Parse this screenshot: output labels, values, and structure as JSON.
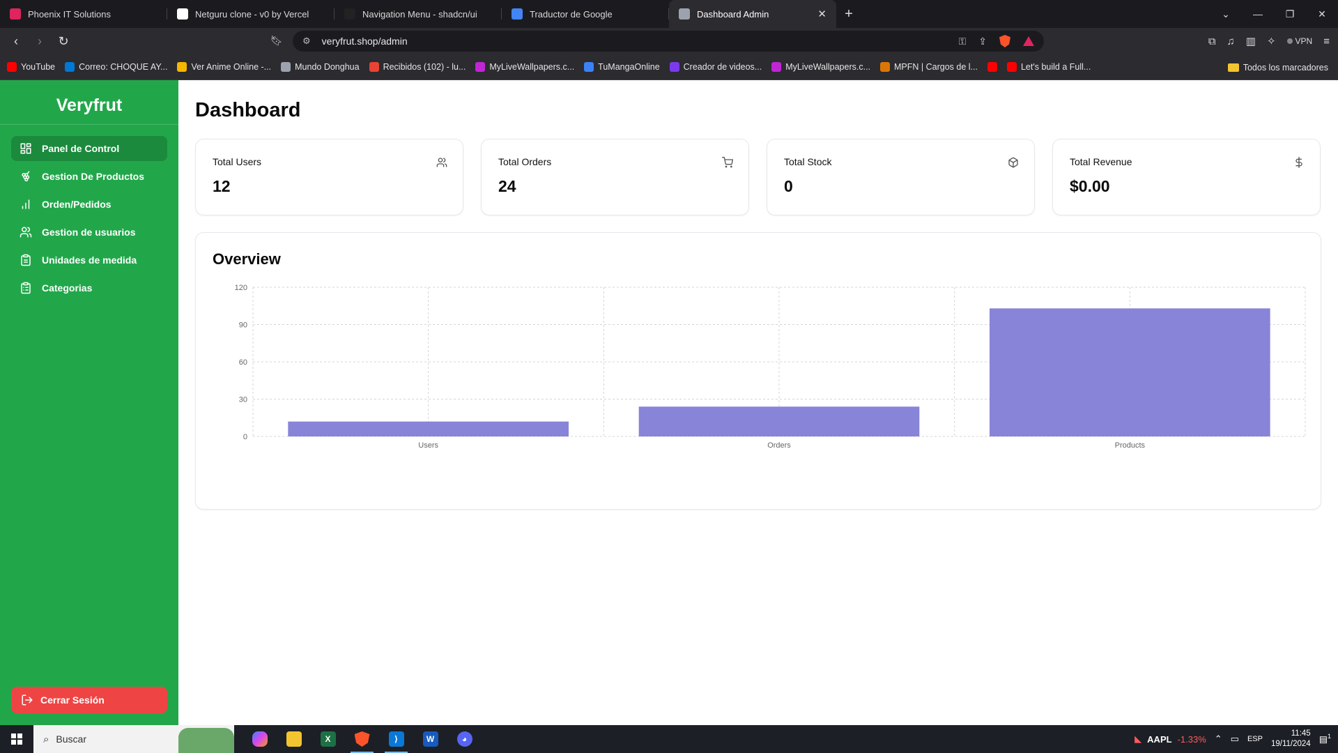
{
  "browser": {
    "tabs": [
      {
        "title": "Phoenix IT Solutions",
        "color": "#e0245e",
        "active": false
      },
      {
        "title": "Netguru clone - v0 by Vercel",
        "color": "#ffffff",
        "active": false
      },
      {
        "title": "Navigation Menu - shadcn/ui",
        "color": "#222222",
        "active": false
      },
      {
        "title": "Traductor de Google",
        "color": "#4285f4",
        "active": false
      },
      {
        "title": "Dashboard Admin",
        "color": "#9ca3af",
        "active": true
      }
    ],
    "url": "veryfrut.shop/admin",
    "vpn_label": "VPN",
    "bookmarks": [
      {
        "label": "YouTube",
        "color": "#ff0000"
      },
      {
        "label": "Correo: CHOQUE AY...",
        "color": "#0078d4"
      },
      {
        "label": "Ver Anime Online -...",
        "color": "#f5b700"
      },
      {
        "label": "Mundo Donghua",
        "color": "#9ca3af"
      },
      {
        "label": "Recibidos (102) - lu...",
        "color": "#ea4335"
      },
      {
        "label": "MyLiveWallpapers.c...",
        "color": "#c026d3"
      },
      {
        "label": "TuMangaOnline",
        "color": "#3b82f6"
      },
      {
        "label": "Creador de videos...",
        "color": "#7c3aed"
      },
      {
        "label": "MyLiveWallpapers.c...",
        "color": "#c026d3"
      },
      {
        "label": "MPFN | Cargos de l...",
        "color": "#d97706"
      },
      {
        "label": "",
        "color": "#ff0000"
      },
      {
        "label": "Let's build a Full...",
        "color": "#ff0000"
      }
    ],
    "all_bookmarks": "Todos los marcadores"
  },
  "sidebar": {
    "brand": "Veryfrut",
    "items": [
      {
        "label": "Panel de Control",
        "icon": "layout-dashboard-icon",
        "active": true
      },
      {
        "label": "Gestion De Productos",
        "icon": "grape-icon",
        "active": false
      },
      {
        "label": "Orden/Pedidos",
        "icon": "bar-chart-icon",
        "active": false
      },
      {
        "label": "Gestion de usuarios",
        "icon": "users-icon",
        "active": false
      },
      {
        "label": "Unidades de medida",
        "icon": "clipboard-icon",
        "active": false
      },
      {
        "label": "Categorias",
        "icon": "clipboard-list-icon",
        "active": false
      }
    ],
    "logout": "Cerrar Sesión"
  },
  "main": {
    "title": "Dashboard",
    "cards": [
      {
        "label": "Total Users",
        "value": "12",
        "icon": "users-icon"
      },
      {
        "label": "Total Orders",
        "value": "24",
        "icon": "shopping-cart-icon"
      },
      {
        "label": "Total Stock",
        "value": "0",
        "icon": "package-icon"
      },
      {
        "label": "Total Revenue",
        "value": "$0.00",
        "icon": "dollar-sign-icon"
      }
    ],
    "overview_title": "Overview"
  },
  "chart_data": {
    "type": "bar",
    "title": "Overview",
    "categories": [
      "Users",
      "Orders",
      "Products"
    ],
    "values": [
      12,
      24,
      103
    ],
    "ylim": [
      0,
      120
    ],
    "yticks": [
      0,
      30,
      60,
      90,
      120
    ],
    "grid": true,
    "bar_color": "#8884d8"
  },
  "taskbar": {
    "search_placeholder": "Buscar",
    "stock_symbol": "AAPL",
    "stock_change": "-1.33%",
    "language": "ESP",
    "time": "11:45",
    "date": "19/11/2024",
    "notification_count": "1"
  }
}
